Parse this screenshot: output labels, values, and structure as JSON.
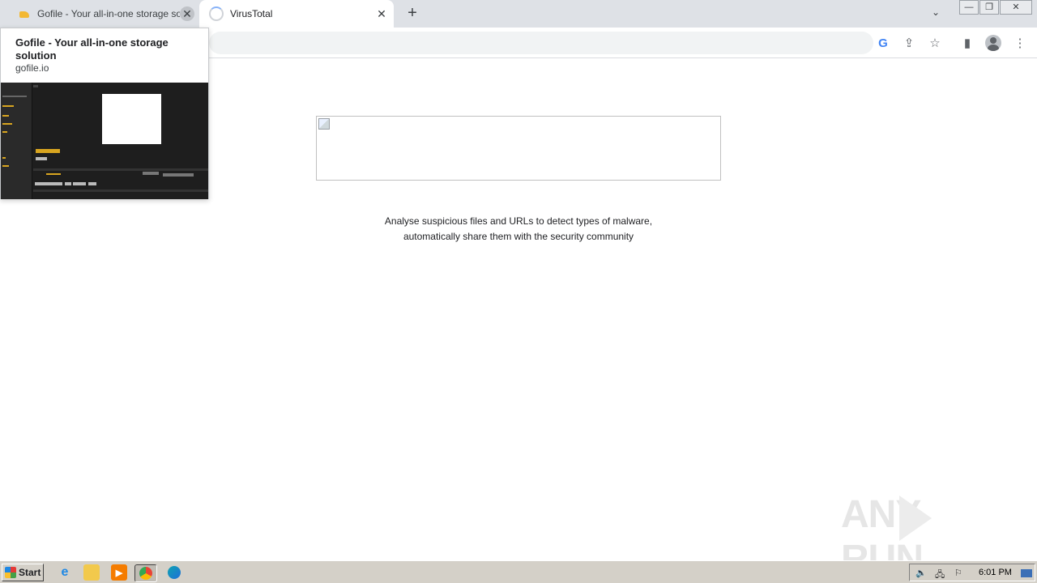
{
  "browser": {
    "tabs": [
      {
        "title": "Gofile - Your all-in-one storage soluti",
        "favicon": "gofile-folder-icon",
        "active": false
      },
      {
        "title": "VirusTotal",
        "favicon": "loading-spinner-icon",
        "active": true
      }
    ],
    "new_tab_label": "+",
    "tab_search_label": "⌄",
    "window_controls": {
      "minimize": "—",
      "restore": "❐",
      "close": "✕"
    }
  },
  "hovercard": {
    "title": "Gofile - Your all-in-one storage solution",
    "url": "gofile.io"
  },
  "page": {
    "tagline_line1": "Analyse suspicious files and URLs to detect types of malware,",
    "tagline_line2": "automatically share them with the security community"
  },
  "watermark": {
    "left": "ANY",
    "right": "RUN"
  },
  "taskbar": {
    "start_label": "Start",
    "clock": "6:01 PM",
    "pinned": [
      "internet-explorer-icon",
      "file-explorer-icon",
      "media-player-icon",
      "chrome-icon",
      "edge-icon"
    ]
  },
  "colors": {
    "accent": "#1a73e8",
    "gofile_yellow": "#d8a520",
    "taskbar": "#d4d0c8"
  }
}
